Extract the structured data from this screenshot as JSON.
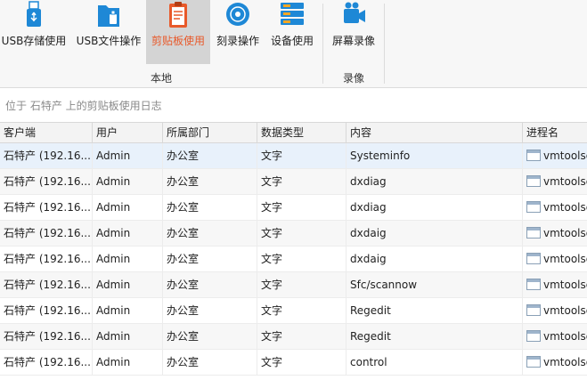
{
  "ribbon": {
    "groups": [
      {
        "label": "本地",
        "buttons": [
          {
            "label": "USB存储使用",
            "icon": "usb-storage-icon",
            "active": false
          },
          {
            "label": "USB文件操作",
            "icon": "usb-folder-icon",
            "active": false
          },
          {
            "label": "剪贴板使用",
            "icon": "clipboard-icon",
            "active": true
          },
          {
            "label": "刻录操作",
            "icon": "disc-burn-icon",
            "active": false
          },
          {
            "label": "设备使用",
            "icon": "device-stack-icon",
            "active": false
          }
        ]
      },
      {
        "label": "录像",
        "buttons": [
          {
            "label": "屏幕录像",
            "icon": "screen-record-icon",
            "active": false
          }
        ]
      }
    ]
  },
  "caption": "位于 石特产 上的剪贴板使用日志",
  "table": {
    "columns": [
      "客户端",
      "用户",
      "所属部门",
      "数据类型",
      "内容",
      "进程名"
    ],
    "rows": [
      [
        "石特产 (192.16...",
        "Admin",
        "办公室",
        "文字",
        "Systeminfo",
        "vmtoolsd"
      ],
      [
        "石特产 (192.16...",
        "Admin",
        "办公室",
        "文字",
        "dxdiag",
        "vmtoolsd"
      ],
      [
        "石特产 (192.16...",
        "Admin",
        "办公室",
        "文字",
        "dxdiag",
        "vmtoolsd"
      ],
      [
        "石特产 (192.16...",
        "Admin",
        "办公室",
        "文字",
        "dxdaig",
        "vmtoolsd"
      ],
      [
        "石特产 (192.16...",
        "Admin",
        "办公室",
        "文字",
        "dxdaig",
        "vmtoolsd"
      ],
      [
        "石特产 (192.16...",
        "Admin",
        "办公室",
        "文字",
        "Sfc/scannow",
        "vmtoolsd"
      ],
      [
        "石特产 (192.16...",
        "Admin",
        "办公室",
        "文字",
        "Regedit",
        "vmtoolsd"
      ],
      [
        "石特产 (192.16...",
        "Admin",
        "办公室",
        "文字",
        "Regedit",
        "vmtoolsd"
      ],
      [
        "石特产 (192.16...",
        "Admin",
        "办公室",
        "文字",
        "control",
        "vmtoolsd"
      ]
    ]
  },
  "colors": {
    "accent": "#e8592a",
    "selected_row": "#e8f1fb",
    "icon_blue": "#1e88d6"
  }
}
